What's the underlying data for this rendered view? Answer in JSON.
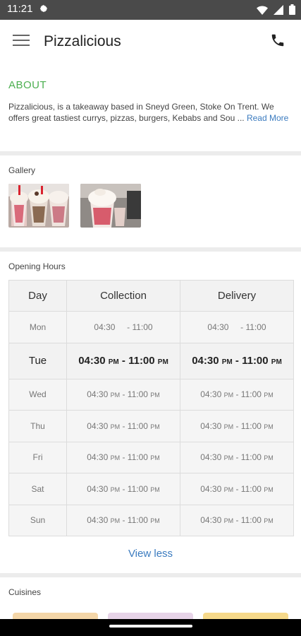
{
  "status_bar": {
    "time": "11:21"
  },
  "app_bar": {
    "title": "Pizzalicious"
  },
  "about": {
    "heading": "ABOUT",
    "text": "Pizzalicious, is a takeaway based in Sneyd Green, Stoke On Trent. We offers great tastiest currys, pizzas, burgers, Kebabs and Sou ...",
    "read_more": "Read More"
  },
  "gallery": {
    "label": "Gallery"
  },
  "opening_hours": {
    "label": "Opening Hours",
    "headers": [
      "Day",
      "Collection",
      "Delivery"
    ],
    "rows": [
      {
        "day": "Mon",
        "c_from": "04:30",
        "c_from_ap": "",
        "c_to": "- 11:00",
        "c_to_ap": "",
        "d_from": "04:30",
        "d_from_ap": "",
        "d_to": "- 11:00",
        "d_to_ap": ""
      },
      {
        "day": "Tue",
        "c_from": "04:30",
        "c_from_ap": "PM",
        "c_to": "- 11:00",
        "c_to_ap": "PM",
        "d_from": "04:30",
        "d_from_ap": "PM",
        "d_to": "- 11:00",
        "d_to_ap": "PM"
      },
      {
        "day": "Wed",
        "c_from": "04:30",
        "c_from_ap": "PM",
        "c_to": "- 11:00",
        "c_to_ap": "PM",
        "d_from": "04:30",
        "d_from_ap": "PM",
        "d_to": "- 11:00",
        "d_to_ap": "PM"
      },
      {
        "day": "Thu",
        "c_from": "04:30",
        "c_from_ap": "PM",
        "c_to": "- 11:00",
        "c_to_ap": "PM",
        "d_from": "04:30",
        "d_from_ap": "PM",
        "d_to": "- 11:00",
        "d_to_ap": "PM"
      },
      {
        "day": "Fri",
        "c_from": "04:30",
        "c_from_ap": "PM",
        "c_to": "- 11:00",
        "c_to_ap": "PM",
        "d_from": "04:30",
        "d_from_ap": "PM",
        "d_to": "- 11:00",
        "d_to_ap": "PM"
      },
      {
        "day": "Sat",
        "c_from": "04:30",
        "c_from_ap": "PM",
        "c_to": "- 11:00",
        "c_to_ap": "PM",
        "d_from": "04:30",
        "d_from_ap": "PM",
        "d_to": "- 11:00",
        "d_to_ap": "PM"
      },
      {
        "day": "Sun",
        "c_from": "04:30",
        "c_from_ap": "PM",
        "c_to": "- 11:00",
        "c_to_ap": "PM",
        "d_from": "04:30",
        "d_from_ap": "PM",
        "d_to": "- 11:00",
        "d_to_ap": "PM"
      }
    ],
    "view_less": "View less"
  },
  "cuisines": {
    "label": "Cuisines"
  },
  "colors": {
    "accent_green": "#4caf50",
    "link_blue": "#3b7bbf"
  },
  "icons": {
    "status": [
      "gear-icon",
      "wifi-icon",
      "signal-icon",
      "battery-icon"
    ],
    "menu": "hamburger-icon",
    "call": "phone-icon"
  }
}
